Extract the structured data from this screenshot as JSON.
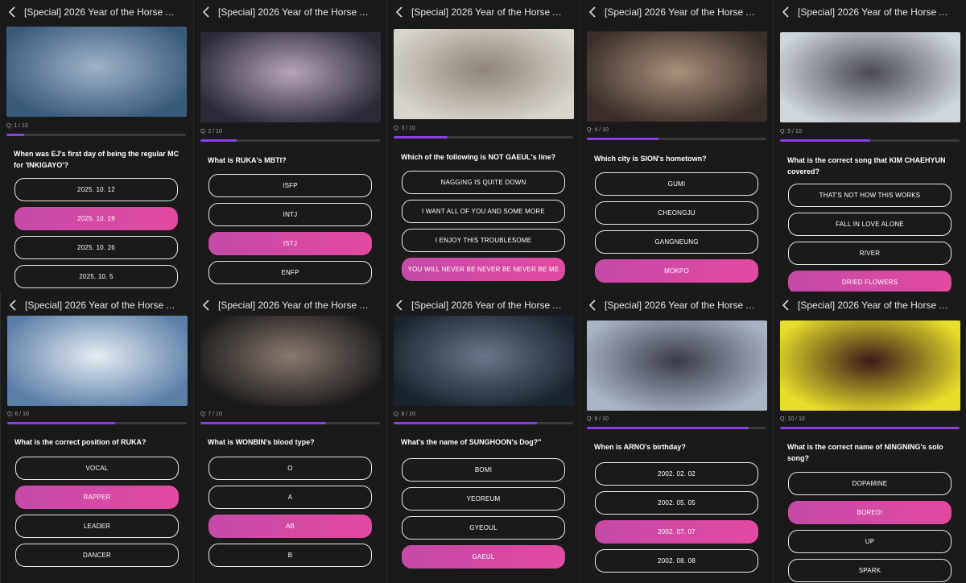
{
  "accent": "#8b3fe0",
  "selected_color": "#d84aa4",
  "panels": [
    {
      "title": "[Special] 2026 Year of the Horse Artis...",
      "qnum": "Q: 1 / 10",
      "progress": 0.1,
      "question": "When was EJ's first day of being the regular MC for 'INKIGAYO'?",
      "options": [
        "2025. 10. 12",
        "2025. 10. 19",
        "2025. 10. 26",
        "2025. 10. 5"
      ],
      "selected": 1
    },
    {
      "title": "[Special] 2026 Year of the Horse Artis...",
      "qnum": "Q: 2 / 10",
      "progress": 0.2,
      "question": "What is RUKA's MBTI?",
      "options": [
        "ISFP",
        "INTJ",
        "ISTJ",
        "ENFP"
      ],
      "selected": 2
    },
    {
      "title": "[Special] 2026 Year of the Horse Artis...",
      "qnum": "Q: 3 / 10",
      "progress": 0.3,
      "question": "Which of the following is NOT GAEUL's line?",
      "options": [
        "NAGGING IS QUITE DOWN",
        "I WANT ALL OF YOU AND SOME MORE",
        "I ENJOY THIS TROUBLESOME",
        "YOU WILL NEVER BE NEVER BE NEVER BE ME"
      ],
      "selected": 3
    },
    {
      "title": "[Special] 2026 Year of the Horse Artis...",
      "qnum": "Q: 4 / 10",
      "progress": 0.4,
      "question": "Which city is SION's hometown?",
      "options": [
        "GUMI",
        "CHEONGJU",
        "GANGNEUNG",
        "MOKPO"
      ],
      "selected": 3
    },
    {
      "title": "[Special] 2026 Year of the Horse Artis...",
      "qnum": "Q: 5 / 10",
      "progress": 0.5,
      "question": "What is the correct song that KIM CHAEHYUN covered?",
      "options": [
        "THAT'S NOT HOW THIS WORKS",
        "FALL IN LOVE ALONE",
        "RIVER",
        "DRIED FLOWERS"
      ],
      "selected": 3
    },
    {
      "title": "[Special] 2026 Year of the Horse Artis...",
      "qnum": "Q: 6 / 10",
      "progress": 0.6,
      "question": "What is the correct position of RUKA?",
      "options": [
        "VOCAL",
        "RAPPER",
        "LEADER",
        "DANCER"
      ],
      "selected": 1
    },
    {
      "title": "[Special] 2026 Year of the Horse Artis...",
      "qnum": "Q: 7 / 10",
      "progress": 0.7,
      "question": "What is WONBIN's blood type?",
      "options": [
        "O",
        "A",
        "AB",
        "B"
      ],
      "selected": 2
    },
    {
      "title": "[Special] 2026 Year of the Horse Artis...",
      "qnum": "Q: 8 / 10",
      "progress": 0.8,
      "question": "What's the name of SUNGHOON's Dog?\"",
      "options": [
        "BOMI",
        "YEOREUM",
        "GYEOUL",
        "GAEUL"
      ],
      "selected": 3
    },
    {
      "title": "[Special] 2026 Year of the Horse Artis...",
      "qnum": "Q: 9 / 10",
      "progress": 0.9,
      "question": "When is ARNO's birthday?",
      "options": [
        "2002. 02. 02",
        "2002. 05. 05",
        "2002. 07. 07",
        "2002. 08. 08"
      ],
      "selected": 2
    },
    {
      "title": "[Special] 2026 Year of the Horse Artis...",
      "qnum": "Q: 10 / 10",
      "progress": 1.0,
      "question": "What is the correct name of NINGNING's solo song?",
      "options": [
        "DOPAMINE",
        "BORED!",
        "UP",
        "SPARK"
      ],
      "selected": 1
    }
  ]
}
